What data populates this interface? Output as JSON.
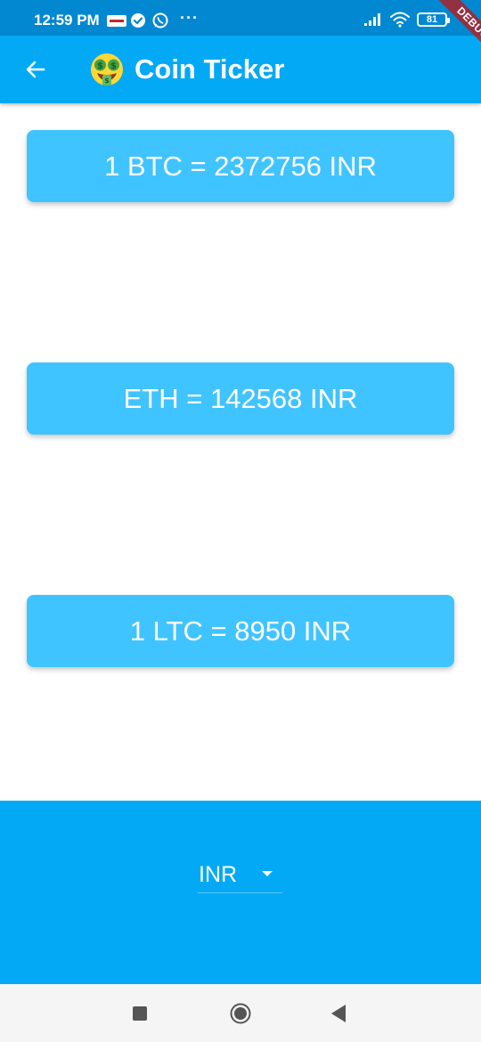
{
  "status_bar": {
    "time": "12:59 PM",
    "battery": "81",
    "more": "···"
  },
  "app_bar": {
    "title": "Coin Ticker",
    "debug_label": "DEBUG"
  },
  "rates": [
    {
      "text": "1 BTC = 2372756 INR"
    },
    {
      "text": "ETH = 142568 INR"
    },
    {
      "text": "1 LTC = 8950 INR"
    }
  ],
  "currency_selector": {
    "selected": "INR"
  },
  "colors": {
    "status_bar": "#0288d1",
    "app_bar": "#03a9f4",
    "card": "#40c4ff",
    "bottom_panel": "#03a9f4"
  },
  "icons": {
    "back": "arrow-left-icon",
    "emoji": "money-mouth-face-icon",
    "dropdown": "caret-down-icon"
  }
}
